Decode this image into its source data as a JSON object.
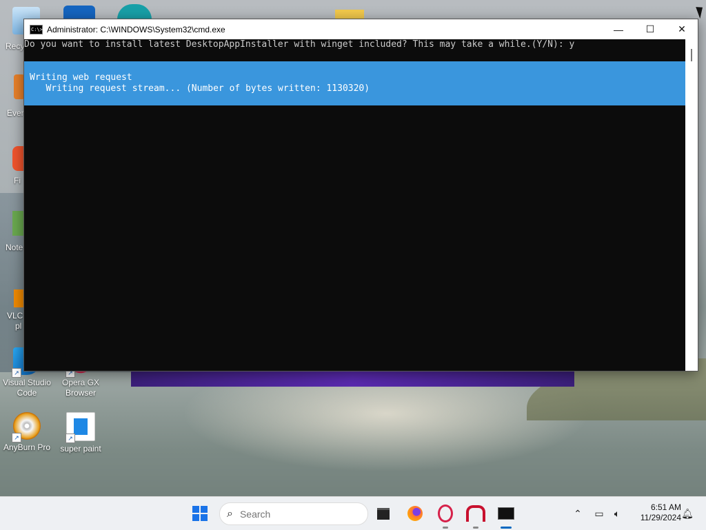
{
  "window": {
    "title": "Administrator: C:\\WINDOWS\\System32\\cmd.exe",
    "buttons": {
      "minimize": "—",
      "maximize": "☐",
      "close": "✕"
    },
    "icon_text": "C:\\>"
  },
  "console": {
    "prompt_line": "Do you want to install latest DesktopAppInstaller with winget included? This may take a while.(Y/N): y",
    "progress_title": "Writing web request",
    "progress_detail": "   Writing request stream... (Number of bytes written: 1130320)"
  },
  "desktop": {
    "icons": [
      {
        "name": "visual-studio-code",
        "label": "Visual Studio Code",
        "color": "#1f7fd6"
      },
      {
        "name": "opera-gx-browser",
        "label": "Opera GX Browser",
        "color": "#d6214a"
      },
      {
        "name": "anyburn-pro",
        "label": "AnyBurn Pro",
        "color": "#e8a020"
      },
      {
        "name": "super-paint",
        "label": "super paint",
        "color": "#1e88e5"
      }
    ],
    "partial_labels": [
      "Recy",
      "Ever",
      "Fi",
      "Note",
      "VLC",
      "pl"
    ]
  },
  "taskbar": {
    "search_placeholder": "Search",
    "time": "6:51 AM",
    "date": "11/29/2024",
    "apps": [
      "start",
      "search",
      "file-manager",
      "firefox",
      "opera",
      "anyburn",
      "cmd"
    ]
  },
  "colors": {
    "console_bg": "#0c0c0c",
    "progress_bg": "#3a96dd",
    "accent": "#0067c0"
  }
}
